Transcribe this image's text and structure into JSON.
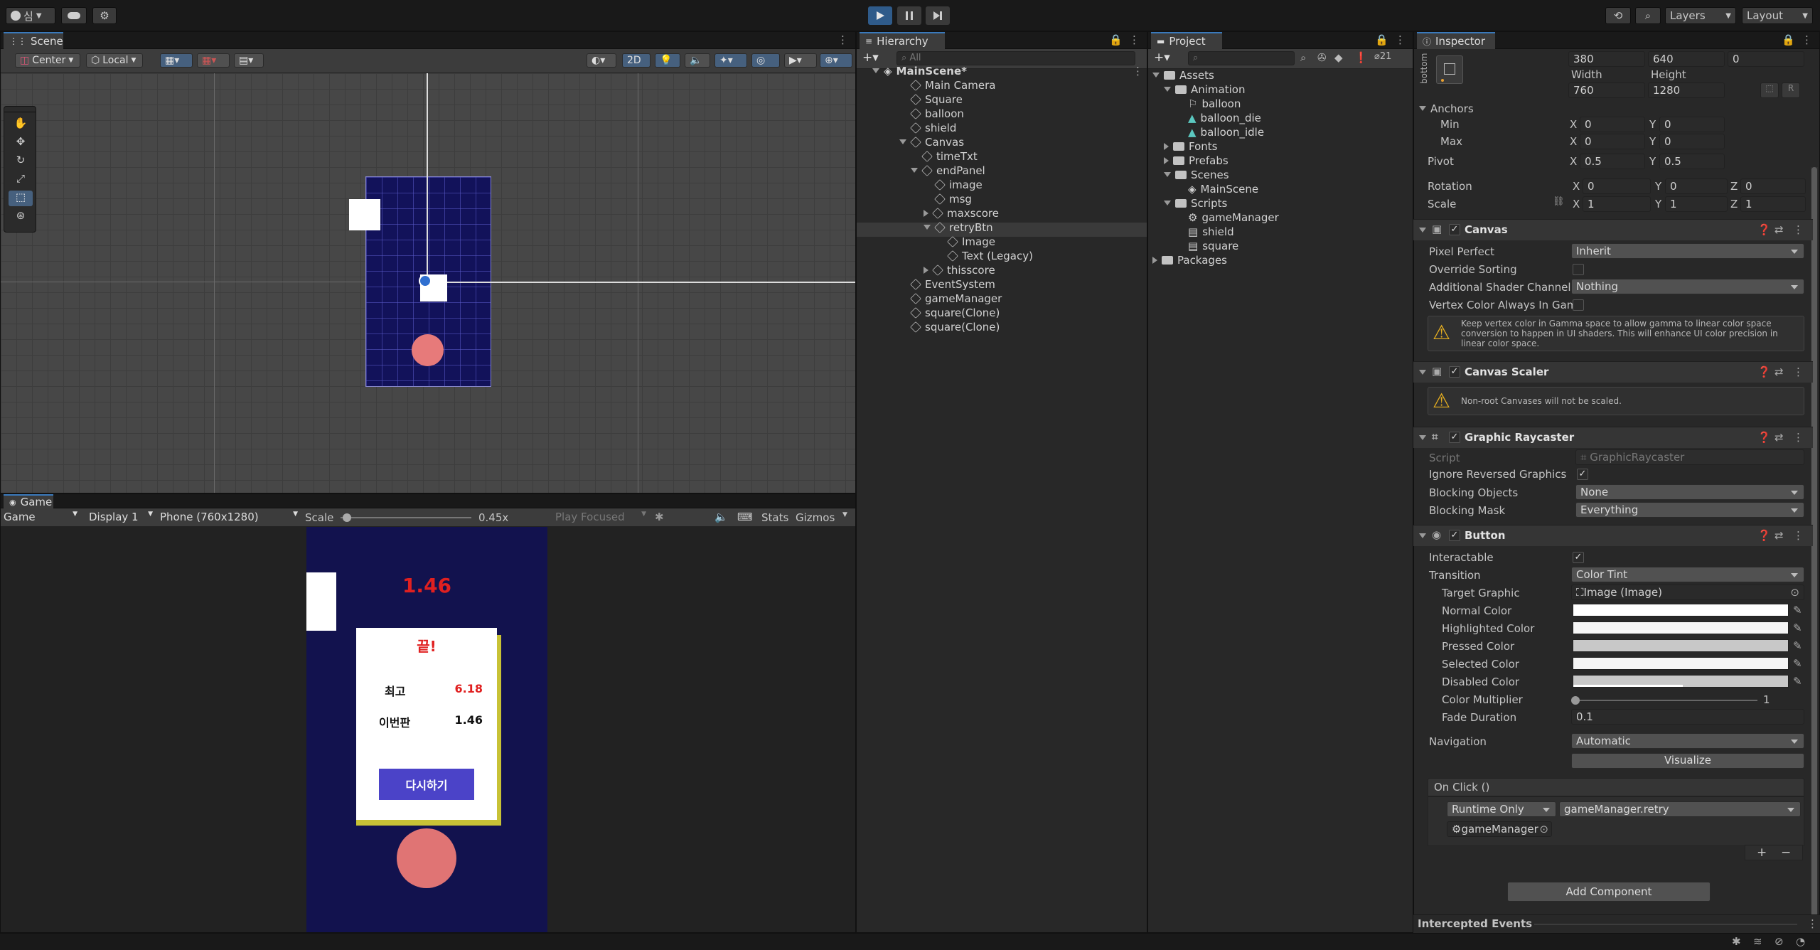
{
  "topbar": {
    "account_label": "심",
    "layers_label": "Layers",
    "layout_label": "Layout"
  },
  "scene": {
    "tab_label": "Scene",
    "pivot_label": "Center",
    "space_label": "Local",
    "mode_2d": "2D"
  },
  "game": {
    "tab_label": "Game",
    "view_select": "Game",
    "display_select": "Display 1",
    "resolution_select": "Phone (760x1280)",
    "scale_label": "Scale",
    "scale_value": "0.45x",
    "scale_fraction": 0.05,
    "play_focused": "Play Focused",
    "stats_label": "Stats",
    "gizmos_label": "Gizmos",
    "timer_text": "1.46",
    "panel_title": "끝!",
    "best_label": "최고",
    "best_value": "6.18",
    "this_label": "이번판",
    "this_value": "1.46",
    "retry_label": "다시하기"
  },
  "hierarchy": {
    "tab_label": "Hierarchy",
    "search_placeholder": "All",
    "items": [
      {
        "label": "MainScene*"
      },
      {
        "label": "Main Camera"
      },
      {
        "label": "Square"
      },
      {
        "label": "balloon"
      },
      {
        "label": "shield"
      },
      {
        "label": "Canvas"
      },
      {
        "label": "timeTxt"
      },
      {
        "label": "endPanel"
      },
      {
        "label": "image"
      },
      {
        "label": "msg"
      },
      {
        "label": "maxscore"
      },
      {
        "label": "retryBtn"
      },
      {
        "label": "Image"
      },
      {
        "label": "Text (Legacy)"
      },
      {
        "label": "thisscore"
      },
      {
        "label": "EventSystem"
      },
      {
        "label": "gameManager"
      },
      {
        "label": "square(Clone)"
      },
      {
        "label": "square(Clone)"
      }
    ]
  },
  "project": {
    "tab_label": "Project",
    "badge_count": "21",
    "items": [
      {
        "label": "Assets"
      },
      {
        "label": "Animation"
      },
      {
        "label": "balloon"
      },
      {
        "label": "balloon_die"
      },
      {
        "label": "balloon_idle"
      },
      {
        "label": "Fonts"
      },
      {
        "label": "Prefabs"
      },
      {
        "label": "Scenes"
      },
      {
        "label": "MainScene"
      },
      {
        "label": "Scripts"
      },
      {
        "label": "gameManager"
      },
      {
        "label": "shield"
      },
      {
        "label": "square"
      },
      {
        "label": "Packages"
      }
    ]
  },
  "inspector": {
    "tab_label": "Inspector",
    "anchor_preset": "bottom",
    "posx": "380",
    "posy": "640",
    "posz": "0",
    "width_label": "Width",
    "height_label": "Height",
    "width": "760",
    "height": "1280",
    "r_label": "R",
    "anchors_label": "Anchors",
    "min_label": "Min",
    "max_label": "Max",
    "min_x": "0",
    "min_y": "0",
    "max_x": "0",
    "max_y": "0",
    "pivot_label": "Pivot",
    "pivot_x": "0.5",
    "pivot_y": "0.5",
    "rotation_label": "Rotation",
    "rot_x": "0",
    "rot_y": "0",
    "rot_z": "0",
    "scale_label": "Scale",
    "scale_x": "1",
    "scale_y": "1",
    "scale_z": "1",
    "axis_x": "X",
    "axis_y": "Y",
    "axis_z": "Z",
    "canvas": {
      "title": "Canvas",
      "pixel_perfect_label": "Pixel Perfect",
      "pixel_perfect": "Inherit",
      "override_sorting_label": "Override Sorting",
      "shader_channels_label": "Additional Shader Channels",
      "shader_channels": "Nothing",
      "vertex_color_label": "Vertex Color Always In Gam",
      "warning": "Keep vertex color in Gamma space to allow gamma to linear color space conversion to happen in UI shaders. This will enhance UI color precision in linear color space."
    },
    "scaler": {
      "title": "Canvas Scaler",
      "warning": "Non-root Canvases will not be scaled."
    },
    "raycaster": {
      "title": "Graphic Raycaster",
      "script_label": "Script",
      "script_value": "GraphicRaycaster",
      "ignore_label": "Ignore Reversed Graphics",
      "blocking_objects_label": "Blocking Objects",
      "blocking_objects": "None",
      "blocking_mask_label": "Blocking Mask",
      "blocking_mask": "Everything"
    },
    "button": {
      "title": "Button",
      "interactable_label": "Interactable",
      "transition_label": "Transition",
      "transition": "Color Tint",
      "target_graphic_label": "Target Graphic",
      "target_graphic": "Image (Image)",
      "normal_label": "Normal Color",
      "highlighted_label": "Highlighted Color",
      "pressed_label": "Pressed Color",
      "selected_label": "Selected Color",
      "disabled_label": "Disabled Color",
      "multiplier_label": "Color Multiplier",
      "multiplier": "1",
      "fade_label": "Fade Duration",
      "fade": "0.1",
      "navigation_label": "Navigation",
      "navigation": "Automatic",
      "visualize_label": "Visualize",
      "onclick_label": "On Click ()",
      "runtime_label": "Runtime Only",
      "function_label": "gameManager.retry",
      "object_label": "gameManager",
      "plus_label": "+",
      "minus_label": "−"
    },
    "add_component": "Add Component",
    "intercepted_events": "Intercepted Events",
    "colors": {
      "normal": "#ffffff",
      "highlighted": "#f5f5f5",
      "pressed": "#c8c8c8",
      "selected": "#f5f5f5",
      "disabled": "#c8c8c8"
    }
  }
}
